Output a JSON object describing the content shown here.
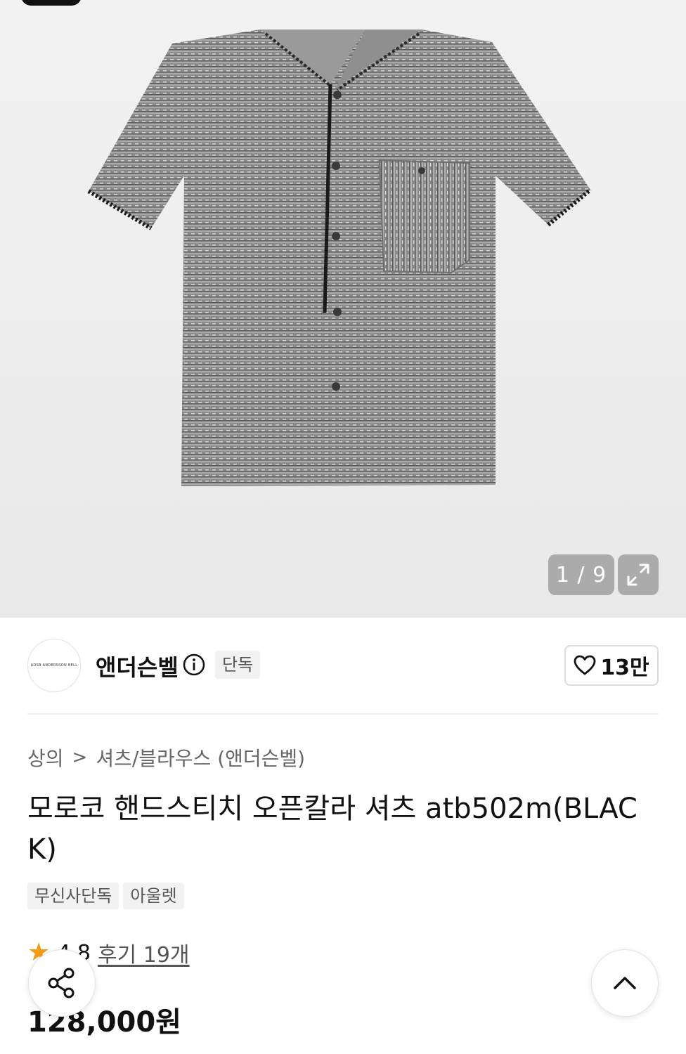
{
  "gallery": {
    "counter": "1 / 9",
    "expand_icon": "expand-icon"
  },
  "brand": {
    "logo_text": "ADSB ANDERSSON BELL",
    "name": "앤더슨벨",
    "info_icon": "info-icon",
    "badge": "단독",
    "likes": "13만",
    "like_icon": "heart-icon"
  },
  "breadcrumb": {
    "category": "상의",
    "separator": ">",
    "subcategory": "셔츠/블라우스 (앤더슨벨)"
  },
  "product": {
    "title": "모로코 핸드스티치 오픈칼라 셔츠 atb502m(BLACK)",
    "tags": [
      "무신사단독",
      "아울렛"
    ],
    "rating": "4.8",
    "reviews": "후기 19개",
    "price": "128,000원"
  },
  "floating": {
    "share_icon": "share-icon",
    "scroll_top_icon": "chevron-up-icon"
  },
  "colors": {
    "star": "#f39c12",
    "counter_bg": "#969696"
  }
}
